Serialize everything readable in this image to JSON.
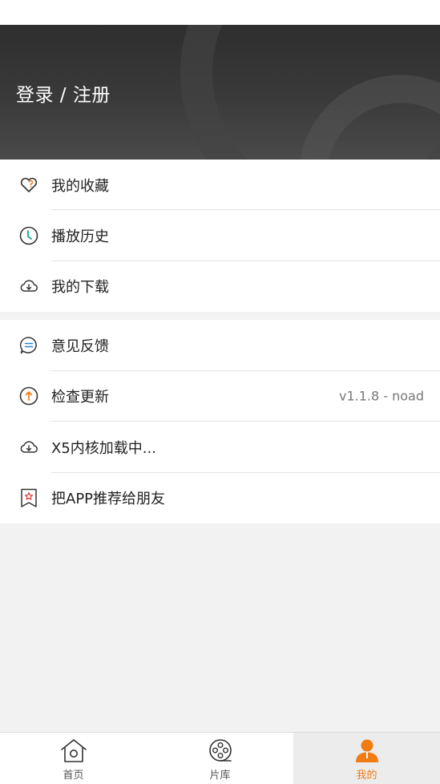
{
  "banner": {
    "login_label": "登录 / 注册"
  },
  "menu_group_1": [
    {
      "label": "我的收藏",
      "icon": "heart-icon"
    },
    {
      "label": "播放历史",
      "icon": "clock-icon"
    },
    {
      "label": "我的下载",
      "icon": "cloud-download-icon"
    }
  ],
  "menu_group_2": [
    {
      "label": "意见反馈",
      "icon": "chat-bubble-icon"
    },
    {
      "label": "检查更新",
      "icon": "arrow-up-circle-icon",
      "value": "v1.1.8 - noad"
    },
    {
      "label": "X5内核加载中...",
      "icon": "cloud-download-icon"
    },
    {
      "label": "把APP推荐给朋友",
      "icon": "bookmark-star-icon"
    }
  ],
  "tabbar": {
    "tabs": [
      {
        "label": "首页",
        "icon": "home-icon"
      },
      {
        "label": "片库",
        "icon": "film-reel-icon"
      },
      {
        "label": "我的",
        "icon": "user-icon"
      }
    ],
    "active_index": 2
  },
  "colors": {
    "accent": "#f07c13",
    "clock": "#1aa58a",
    "chat": "#1e88e5",
    "update": "#f07c13",
    "bookmark": "#e53935"
  }
}
